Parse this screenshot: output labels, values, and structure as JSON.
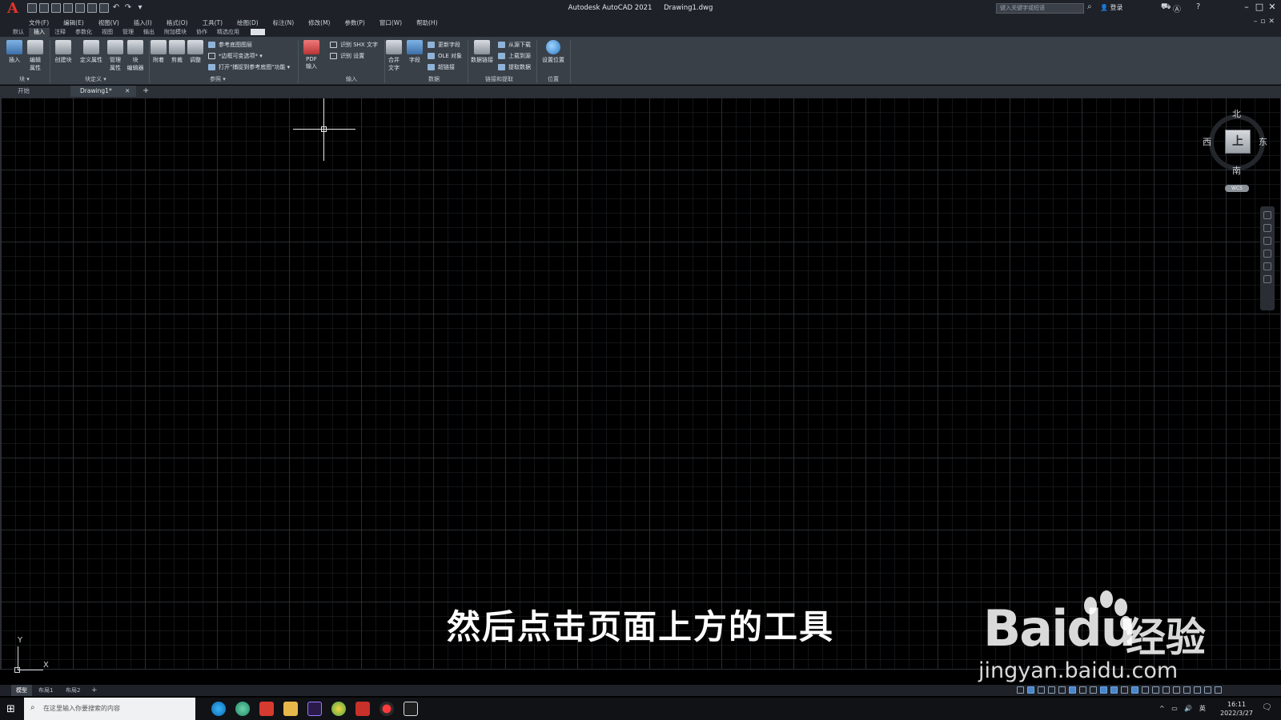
{
  "titlebar": {
    "app": "Autodesk AutoCAD 2021",
    "file": "Drawing1.dwg",
    "search_placeholder": "键入关键字或短语",
    "login": "登录",
    "logo": "A"
  },
  "menu": [
    "文件(F)",
    "编辑(E)",
    "视图(V)",
    "插入(I)",
    "格式(O)",
    "工具(T)",
    "绘图(D)",
    "标注(N)",
    "修改(M)",
    "参数(P)",
    "窗口(W)",
    "帮助(H)"
  ],
  "ribbon_tabs": {
    "items": [
      "默认",
      "插入",
      "注释",
      "参数化",
      "视图",
      "管理",
      "输出",
      "附加模块",
      "协作",
      "精选应用"
    ],
    "active_index": 1
  },
  "ribbon": {
    "block": {
      "insert": "插入",
      "edit_attr": "编辑\n属性",
      "title": "块 ▾"
    },
    "block_def": {
      "create": "创建块",
      "define_attr": "定义属性",
      "manage_attr": "管理\n属性",
      "block_editor": "块\n编辑器",
      "title": "块定义 ▾"
    },
    "reference": {
      "attach": "附着",
      "clip": "剪裁",
      "adjust": "调整",
      "underlay_layers": "参考底图图层",
      "frames": "*边框可变选项*",
      "snap": "打开\"捕捉到参考底图\"功能",
      "title": "参照 ▾"
    },
    "import": {
      "pdf": "PDF\n输入",
      "shx": "识别 SHX 文字",
      "settings": "识别 设置",
      "title": "输入"
    },
    "data": {
      "merge_text": "合并\n文字",
      "field": "字段",
      "update_fields": "更新字段",
      "ole": "OLE 对象",
      "hyperlink": "超链接",
      "title": "数据"
    },
    "linking": {
      "data_link": "数据链接",
      "download": "从源下载",
      "upload": "上载到源",
      "extract": "提取数据",
      "title": "链接和提取"
    },
    "location": {
      "set_location": "设置位置",
      "title": "位置"
    }
  },
  "doc_tabs": {
    "start": "开始",
    "drawing": "Drawing1*"
  },
  "viewcube": {
    "north": "北",
    "south": "南",
    "west": "西",
    "east": "东",
    "face": "上",
    "wcs": "WCS"
  },
  "ucs": {
    "y": "Y",
    "x": "X"
  },
  "subtitle": "然后点击页面上方的工具",
  "watermark": {
    "logo": "Baidu",
    "cn": "经验",
    "url": "jingyan.baidu.com"
  },
  "layout_tabs": [
    "模型",
    "布局1",
    "布局2"
  ],
  "taskbar": {
    "search_placeholder": "在这里输入你要搜索的内容",
    "time": "16:11",
    "date": "2022/3/27",
    "ime": "英"
  }
}
